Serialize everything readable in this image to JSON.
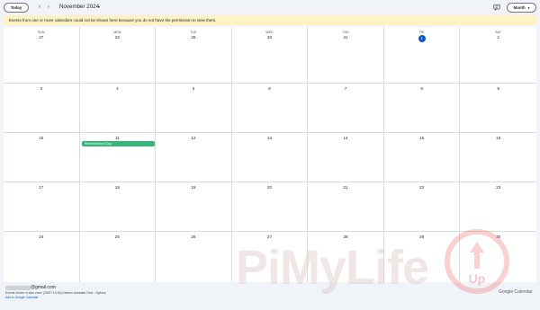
{
  "header": {
    "today_label": "Today",
    "prev_icon": "chevron-left-icon",
    "next_icon": "chevron-right-icon",
    "month_title": "November 2024",
    "view_label": "Month",
    "feedback_icon": "feedback-icon"
  },
  "banner": {
    "message": "Events from one or more calendars could not be shown here because you do not have the permission to view them."
  },
  "calendar": {
    "weekdays": [
      "SUN",
      "MON",
      "TUE",
      "WED",
      "THU",
      "FRI",
      "SAT"
    ],
    "today": "1",
    "weeks": [
      [
        "27",
        "28",
        "29",
        "30",
        "31",
        "1",
        "2"
      ],
      [
        "3",
        "4",
        "5",
        "6",
        "7",
        "8",
        "9"
      ],
      [
        "10",
        "11",
        "12",
        "13",
        "14",
        "15",
        "16"
      ],
      [
        "17",
        "18",
        "19",
        "20",
        "21",
        "22",
        "23"
      ],
      [
        "24",
        "25",
        "26",
        "27",
        "28",
        "29",
        "30"
      ]
    ],
    "events": [
      {
        "week": 2,
        "day": 1,
        "title": "Remembrance Day",
        "color": "#33b679"
      }
    ],
    "today_color": "#0b57d0"
  },
  "watermark": {
    "text": "PiMyLife",
    "logo_text": "Up"
  },
  "footer": {
    "email_suffix": "@gmail.com",
    "timezone": "Events shown in time zone: (GMT+10:30) Eastern Australia Time - Sydney",
    "add_link": "Add to Google Calendar",
    "brand_google": "Google",
    "brand_calendar": " Calendar"
  }
}
